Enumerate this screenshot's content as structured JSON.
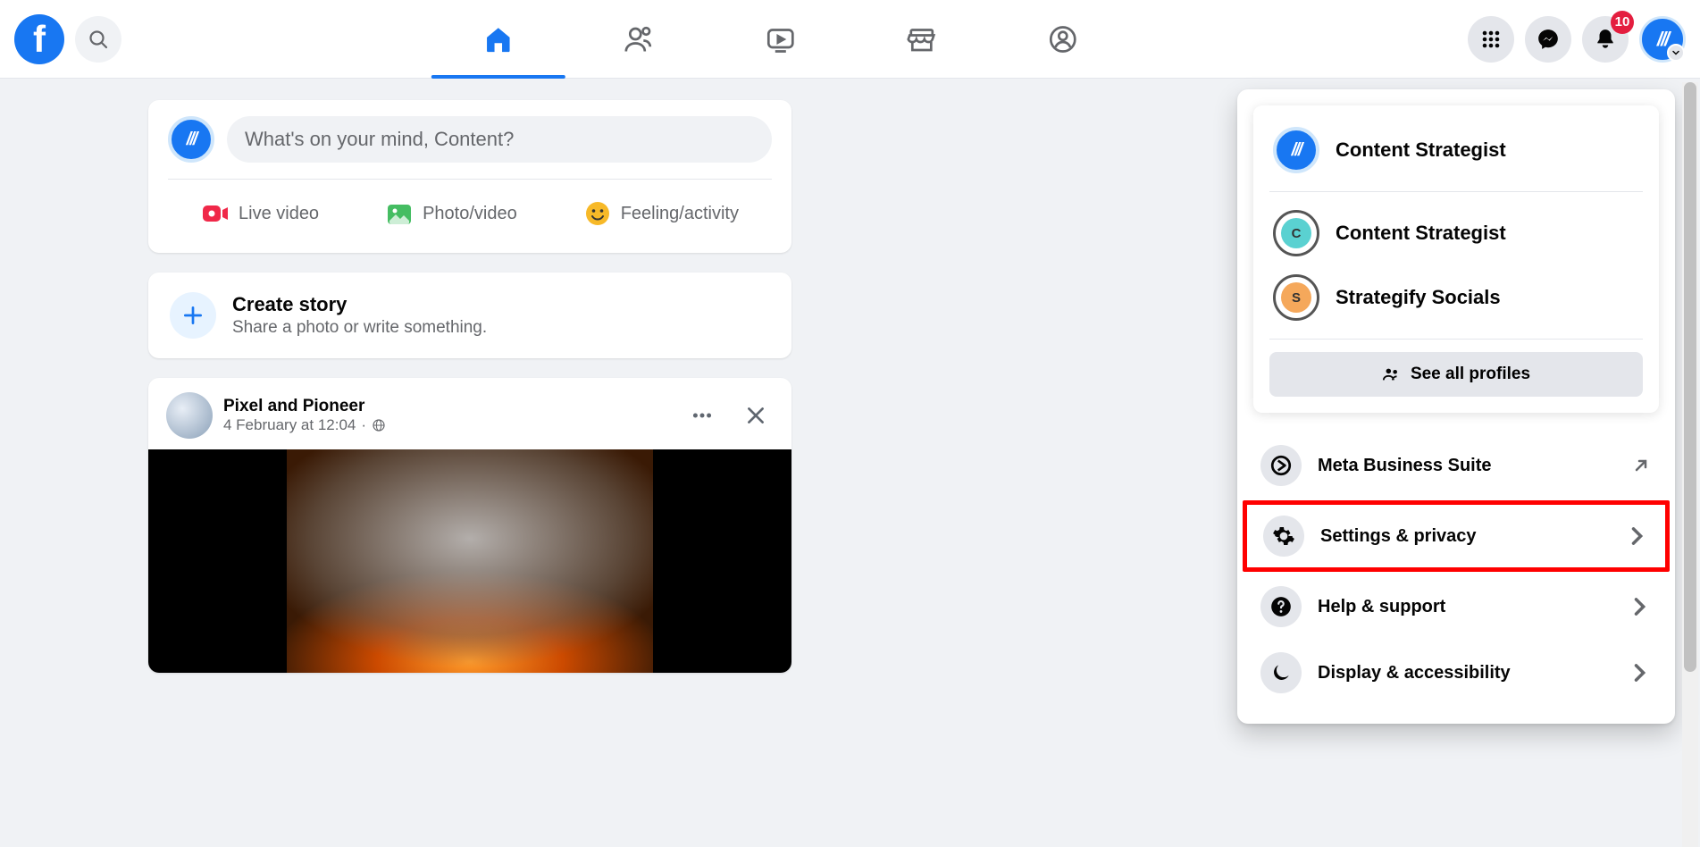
{
  "header": {
    "notification_count": "10"
  },
  "composer": {
    "placeholder": "What's on your mind, Content?",
    "live_label": "Live video",
    "photo_label": "Photo/video",
    "feeling_label": "Feeling/activity"
  },
  "story": {
    "title": "Create story",
    "subtitle": "Share a photo or write something."
  },
  "post": {
    "author": "Pixel and Pioneer",
    "timestamp": "4 February at 12:04"
  },
  "menu": {
    "profiles": [
      {
        "name": "Content Strategist",
        "type": "main"
      },
      {
        "name": "Content Strategist",
        "type": "page",
        "letter": "C",
        "color": "#5ad1d1"
      },
      {
        "name": "Strategify Socials",
        "type": "page",
        "letter": "S",
        "color": "#f5a85b"
      }
    ],
    "see_all": "See all profiles",
    "items": [
      {
        "label": "Meta Business Suite",
        "icon": "business",
        "arrow": "external"
      },
      {
        "label": "Settings & privacy",
        "icon": "gear",
        "arrow": "right",
        "highlight": true
      },
      {
        "label": "Help & support",
        "icon": "help",
        "arrow": "right"
      },
      {
        "label": "Display & accessibility",
        "icon": "moon",
        "arrow": "right"
      }
    ]
  }
}
